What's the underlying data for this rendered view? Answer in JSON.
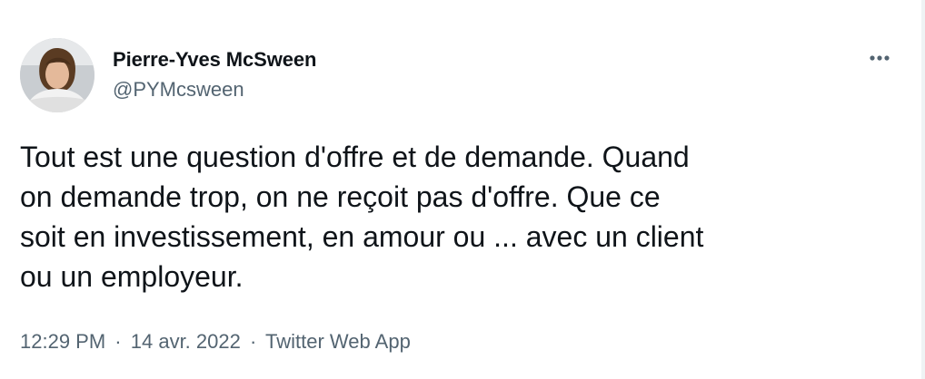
{
  "author": {
    "name": "Pierre-Yves McSween",
    "handle": "@PYMcsween"
  },
  "tweet": {
    "lines": [
      "Tout est une question d'offre et de demande. Quand",
      "on demande trop, on ne reçoit pas d'offre. Que ce",
      "soit en investissement, en amour ou ... avec un client",
      "ou un employeur."
    ]
  },
  "meta": {
    "time": "12:29 PM",
    "separator": "·",
    "date": "14 avr. 2022",
    "source": "Twitter Web App"
  },
  "icons": {
    "more": "more-horizontal-icon",
    "avatar": "profile-photo"
  },
  "colors": {
    "text_primary": "#0f1419",
    "text_secondary": "#536471",
    "background": "#ffffff"
  }
}
